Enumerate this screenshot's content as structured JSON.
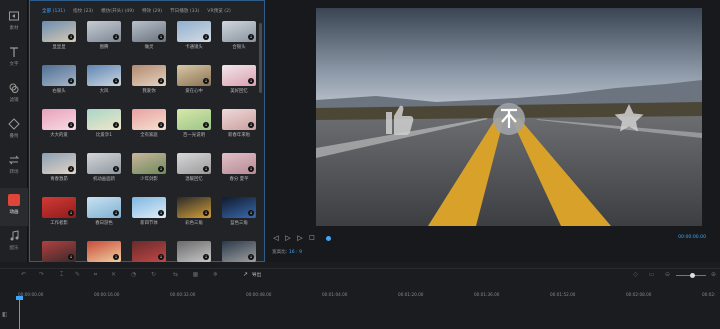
{
  "sidebar": {
    "items": [
      {
        "label": "素材",
        "icon": "media-icon"
      },
      {
        "label": "文字",
        "icon": "text-icon"
      },
      {
        "label": "滤镜",
        "icon": "filter-icon"
      },
      {
        "label": "叠附",
        "icon": "overlay-icon"
      },
      {
        "label": "转场",
        "icon": "transition-icon"
      },
      {
        "label": "动画",
        "icon": "animation-icon"
      },
      {
        "label": "配乐",
        "icon": "music-icon"
      }
    ],
    "active_index": 5
  },
  "panel": {
    "tabs": [
      "全部 (131)",
      "指纹 (23)",
      "模仿(开头) (49)",
      "特效 (29)",
      "节日播放 (33)",
      "VR预览 (2)"
    ],
    "active_tab": 0,
    "items": [
      {
        "label": "显显显",
        "color1": "#6a8db3",
        "color2": "#d8c9b0"
      },
      {
        "label": "图腾",
        "color1": "#c6ccd4",
        "color2": "#7d8794"
      },
      {
        "label": "做灵",
        "color1": "#b7c1cc",
        "color2": "#6a727c"
      },
      {
        "label": "卡通镜头",
        "color1": "#8fb0cf",
        "color2": "#d5dbe2"
      },
      {
        "label": "合银头",
        "color1": "#cfd6df",
        "color2": "#8a939e"
      },
      {
        "label": "右服头",
        "color1": "#4f6f95",
        "color2": "#a7b7c8"
      },
      {
        "label": "大风",
        "color1": "#5e86b3",
        "color2": "#cdd7e2"
      },
      {
        "label": "我爱你",
        "color1": "#b28a6e",
        "color2": "#e6d5c4"
      },
      {
        "label": "爱在心中",
        "color1": "#d9c8a4",
        "color2": "#8a7356"
      },
      {
        "label": "美好回忆",
        "color1": "#f2e6ea",
        "color2": "#d9a0b0"
      },
      {
        "label": "大大的爱",
        "color1": "#e8a0b8",
        "color2": "#f8dde6"
      },
      {
        "label": "比爱孕1",
        "color1": "#a6d6c8",
        "color2": "#f3e6c8"
      },
      {
        "label": "全有家庭",
        "color1": "#e9a0a0",
        "color2": "#f4e3d0"
      },
      {
        "label": "百一光说明",
        "color1": "#d7e8a8",
        "color2": "#9cc48a"
      },
      {
        "label": "新春年来啦",
        "color1": "#f0d8d8",
        "color2": "#c9a0a0"
      },
      {
        "label": "青春激昂",
        "color1": "#8aa0b4",
        "color2": "#e4d4c4"
      },
      {
        "label": "机动画面新",
        "color1": "#d2d6da",
        "color2": "#8f979f"
      },
      {
        "label": "少年剑影",
        "color1": "#c9b69c",
        "color2": "#6f8a5c"
      },
      {
        "label": "温暖回忆",
        "color1": "#d8d8d8",
        "color2": "#9a9a9a"
      },
      {
        "label": "春分 夏芊",
        "color1": "#e2c0c8",
        "color2": "#b58a94"
      },
      {
        "label": "工作者影",
        "color1": "#d23a35",
        "color2": "#8f1c1c"
      },
      {
        "label": "春日游色",
        "color1": "#c9e2f2",
        "color2": "#7fb0d0"
      },
      {
        "label": "新四节体",
        "color1": "#7fb6e0",
        "color2": "#e0eef8"
      },
      {
        "label": "彩色三角",
        "color1": "#2a2a2a",
        "color2": "#d4a03a"
      },
      {
        "label": "蓝色三角",
        "color1": "#101a2a",
        "color2": "#3a6ab0"
      },
      {
        "label": "",
        "color1": "#b34040",
        "color2": "#3a2a2a"
      },
      {
        "label": "",
        "color1": "#c84a3a",
        "color2": "#f0d0a0"
      },
      {
        "label": "",
        "color1": "#6a2a2a",
        "color2": "#c04848"
      },
      {
        "label": "",
        "color1": "#6a6a6a",
        "color2": "#c8c8c8"
      },
      {
        "label": "",
        "color1": "#2a3a4a",
        "color2": "#a0a0a0"
      }
    ]
  },
  "preview": {
    "timecode": "00:00:00.00",
    "ratio_label": "宽高比:",
    "ratio_value": "16 : 9",
    "buttons": [
      "rewind-icon",
      "play-icon",
      "forward-icon",
      "stop-icon"
    ]
  },
  "toolbar": {
    "export_label": "导出"
  },
  "timeline": {
    "ticks": [
      "00:00:00.00",
      "00:00:16.00",
      "00:00:32.00",
      "00:00:48.00",
      "00:01:04.00",
      "00:01:20.00",
      "00:01:36.00",
      "00:01:52.00",
      "00:02:08.00",
      "00:02:"
    ]
  },
  "colors": {
    "accent": "#3ea6ff",
    "active_sidebar": "#e0453a"
  }
}
